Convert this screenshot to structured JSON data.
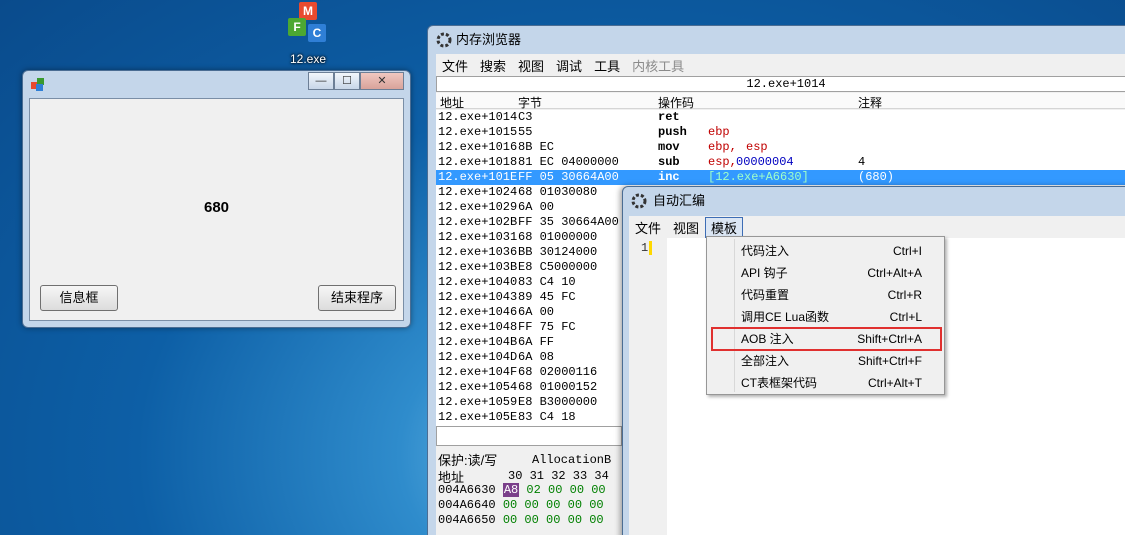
{
  "desktop_icon": {
    "label": "12.exe",
    "letters": [
      "M",
      "F",
      "C"
    ]
  },
  "small_window": {
    "counter": "680",
    "info_button": "信息框",
    "end_button": "结束程序",
    "min_glyph": "—",
    "max_glyph": "☐",
    "close_glyph": "✕"
  },
  "memory_viewer": {
    "title": "内存浏览器",
    "menu": [
      "文件",
      "搜索",
      "视图",
      "调试",
      "工具",
      "内核工具"
    ],
    "address_bar": "12.exe+1014",
    "columns": [
      "地址",
      "字节",
      "操作码",
      "注释"
    ],
    "rows": [
      {
        "addr": "12.exe+1014",
        "bytes": "C3",
        "op": "ret",
        "a1": "",
        "a2": "",
        "a3": "",
        "comment": ""
      },
      {
        "addr": "12.exe+1015",
        "bytes": "55",
        "op": "push",
        "a1": "ebp",
        "a2": "",
        "a3": "",
        "comment": ""
      },
      {
        "addr": "12.exe+1016",
        "bytes": "8B EC",
        "op": "mov",
        "a1": "ebp,",
        "a2": "esp",
        "a3": "",
        "comment": ""
      },
      {
        "addr": "12.exe+1018",
        "bytes": "81 EC 04000000",
        "op": "sub",
        "a1": "esp,",
        "a2": "",
        "a3": "00000004",
        "comment": "4"
      },
      {
        "addr": "12.exe+101E",
        "bytes": "FF 05 30664A00",
        "op": "inc",
        "a1": "[12.exe+A6630]",
        "a2": "",
        "a3": "",
        "comment": "(680)"
      },
      {
        "addr": "12.exe+1024",
        "bytes": "68 01030080",
        "op": "",
        "a1": "",
        "a2": "",
        "a3": "",
        "comment": ""
      },
      {
        "addr": "12.exe+1029",
        "bytes": "6A 00",
        "op": "",
        "a1": "",
        "a2": "",
        "a3": "",
        "comment": ""
      },
      {
        "addr": "12.exe+102B",
        "bytes": "FF 35 30664A00",
        "op": "",
        "a1": "",
        "a2": "",
        "a3": "",
        "comment": ""
      },
      {
        "addr": "12.exe+1031",
        "bytes": "68 01000000",
        "op": "",
        "a1": "",
        "a2": "",
        "a3": "",
        "comment": ""
      },
      {
        "addr": "12.exe+1036",
        "bytes": "BB 30124000",
        "op": "",
        "a1": "",
        "a2": "",
        "a3": "",
        "comment": ""
      },
      {
        "addr": "12.exe+103B",
        "bytes": "E8 C5000000",
        "op": "",
        "a1": "",
        "a2": "",
        "a3": "",
        "comment": ""
      },
      {
        "addr": "12.exe+1040",
        "bytes": "83 C4 10",
        "op": "",
        "a1": "",
        "a2": "",
        "a3": "",
        "comment": ""
      },
      {
        "addr": "12.exe+1043",
        "bytes": "89 45 FC",
        "op": "",
        "a1": "",
        "a2": "",
        "a3": "",
        "comment": ""
      },
      {
        "addr": "12.exe+1046",
        "bytes": "6A 00",
        "op": "",
        "a1": "",
        "a2": "",
        "a3": "",
        "comment": ""
      },
      {
        "addr": "12.exe+1048",
        "bytes": "FF 75 FC",
        "op": "",
        "a1": "",
        "a2": "",
        "a3": "",
        "comment": ""
      },
      {
        "addr": "12.exe+104B",
        "bytes": "6A FF",
        "op": "",
        "a1": "",
        "a2": "",
        "a3": "",
        "comment": ""
      },
      {
        "addr": "12.exe+104D",
        "bytes": "6A 08",
        "op": "",
        "a1": "",
        "a2": "",
        "a3": "",
        "comment": ""
      },
      {
        "addr": "12.exe+104F",
        "bytes": "68 02000116",
        "op": "",
        "a1": "",
        "a2": "",
        "a3": "",
        "comment": ""
      },
      {
        "addr": "12.exe+1054",
        "bytes": "68 01000152",
        "op": "",
        "a1": "",
        "a2": "",
        "a3": "",
        "comment": ""
      },
      {
        "addr": "12.exe+1059",
        "bytes": "E8 B3000000",
        "op": "",
        "a1": "",
        "a2": "",
        "a3": "",
        "comment": ""
      },
      {
        "addr": "12.exe+105E",
        "bytes": "83 C4 18",
        "op": "",
        "a1": "",
        "a2": "",
        "a3": "",
        "comment": ""
      }
    ],
    "selected_row": 4,
    "protection": "保护:读/写",
    "allocation": "AllocationB",
    "hex_addr_label": "地址",
    "hex_columns": "30 31 32 33 34",
    "hex_rows": [
      {
        "addr": "004A6630",
        "first": "A8",
        "rest": "02 00 00 00"
      },
      {
        "addr": "004A6640",
        "first": "00",
        "rest": "00 00 00 00"
      },
      {
        "addr": "004A6650",
        "first": "00",
        "rest": "00 00 00 00"
      }
    ]
  },
  "auto_assemble": {
    "title": "自动汇编",
    "menu": [
      "文件",
      "视图",
      "模板"
    ],
    "line_number": "1"
  },
  "template_menu": {
    "items": [
      {
        "label": "代码注入",
        "shortcut": "Ctrl+I"
      },
      {
        "label": "API 钩子",
        "shortcut": "Ctrl+Alt+A"
      },
      {
        "label": "代码重置",
        "shortcut": "Ctrl+R"
      },
      {
        "label": "调用CE Lua函数",
        "shortcut": "Ctrl+L"
      },
      {
        "label": "AOB 注入",
        "shortcut": "Shift+Ctrl+A"
      },
      {
        "label": "全部注入",
        "shortcut": "Shift+Ctrl+F"
      },
      {
        "label": "CT表框架代码",
        "shortcut": "Ctrl+Alt+T"
      }
    ],
    "highlighted_index": 4,
    "highlight_color": "#e0302f"
  },
  "colors": {
    "selection": "#3399ff",
    "register": "#c00000",
    "immediate": "#0000c0",
    "hex_bytes": "#008000"
  }
}
